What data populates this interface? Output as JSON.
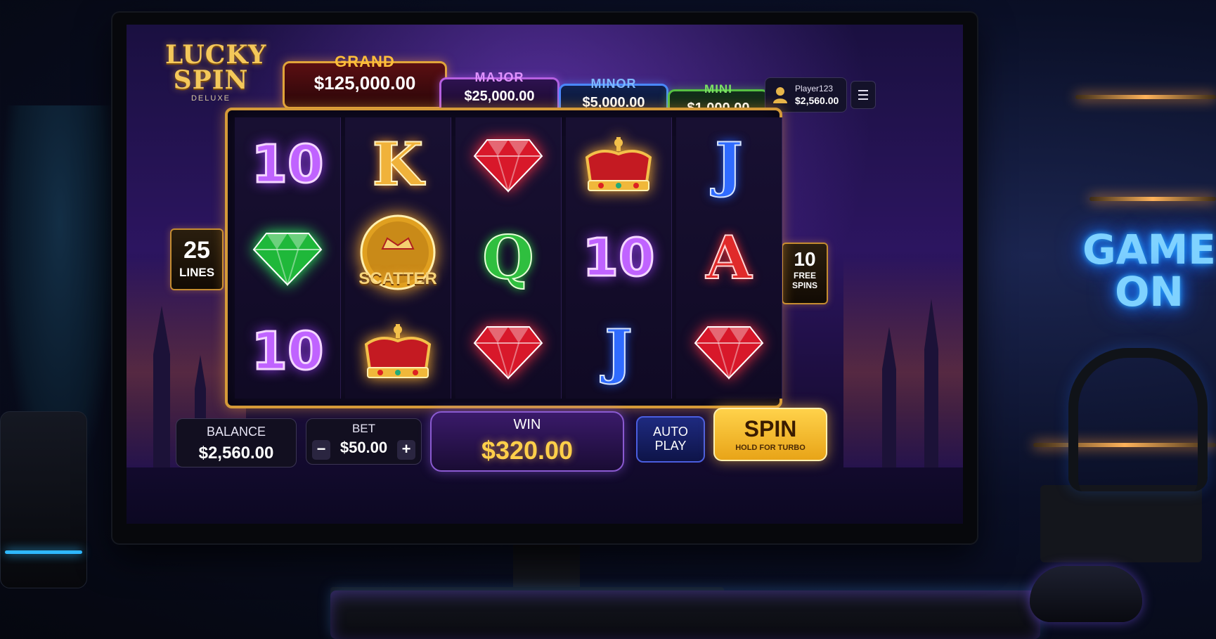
{
  "logo": {
    "line1": "LUCKY",
    "line2": "SPIN",
    "line3": "DELUXE"
  },
  "jackpots": {
    "grand": {
      "label": "GRAND",
      "value": "$125,000.00",
      "color": "#e1a43a"
    },
    "major": {
      "label": "MAJOR",
      "value": "$25,000.00",
      "color": "#b65fe0"
    },
    "minor": {
      "label": "MINOR",
      "value": "$5,000.00",
      "color": "#4a88ff"
    },
    "mini": {
      "label": "MINI",
      "value": "$1,000.00",
      "color": "#56c043"
    }
  },
  "player": {
    "name": "Player123",
    "balance": "$2,560.00",
    "icon": "user-icon"
  },
  "menu": {
    "icon": "hamburger-menu-icon"
  },
  "reels": [
    [
      "10",
      "emerald",
      "10"
    ],
    [
      "K",
      "scatter",
      "crown"
    ],
    [
      "ruby",
      "Q",
      "ruby"
    ],
    [
      "crown",
      "10",
      "J"
    ],
    [
      "J",
      "A",
      "ruby"
    ]
  ],
  "scatter_label": "SCATTER",
  "lines": {
    "value": "25",
    "label": "LINES"
  },
  "free_spins": {
    "value": "10",
    "label1": "FREE",
    "label2": "SPINS"
  },
  "balance": {
    "label": "BALANCE",
    "value": "$2,560.00"
  },
  "bet": {
    "label": "BET",
    "value": "$50.00",
    "minus": "−",
    "plus": "+"
  },
  "win": {
    "label": "WIN",
    "value": "$320.00"
  },
  "autoplay": {
    "line1": "AUTO",
    "line2": "PLAY"
  },
  "spin": {
    "label": "SPIN",
    "sub": "HOLD FOR TURBO"
  },
  "room": {
    "neon_line1": "GAME",
    "neon_line2": "ON",
    "neon_color": "#7fd2ff"
  }
}
